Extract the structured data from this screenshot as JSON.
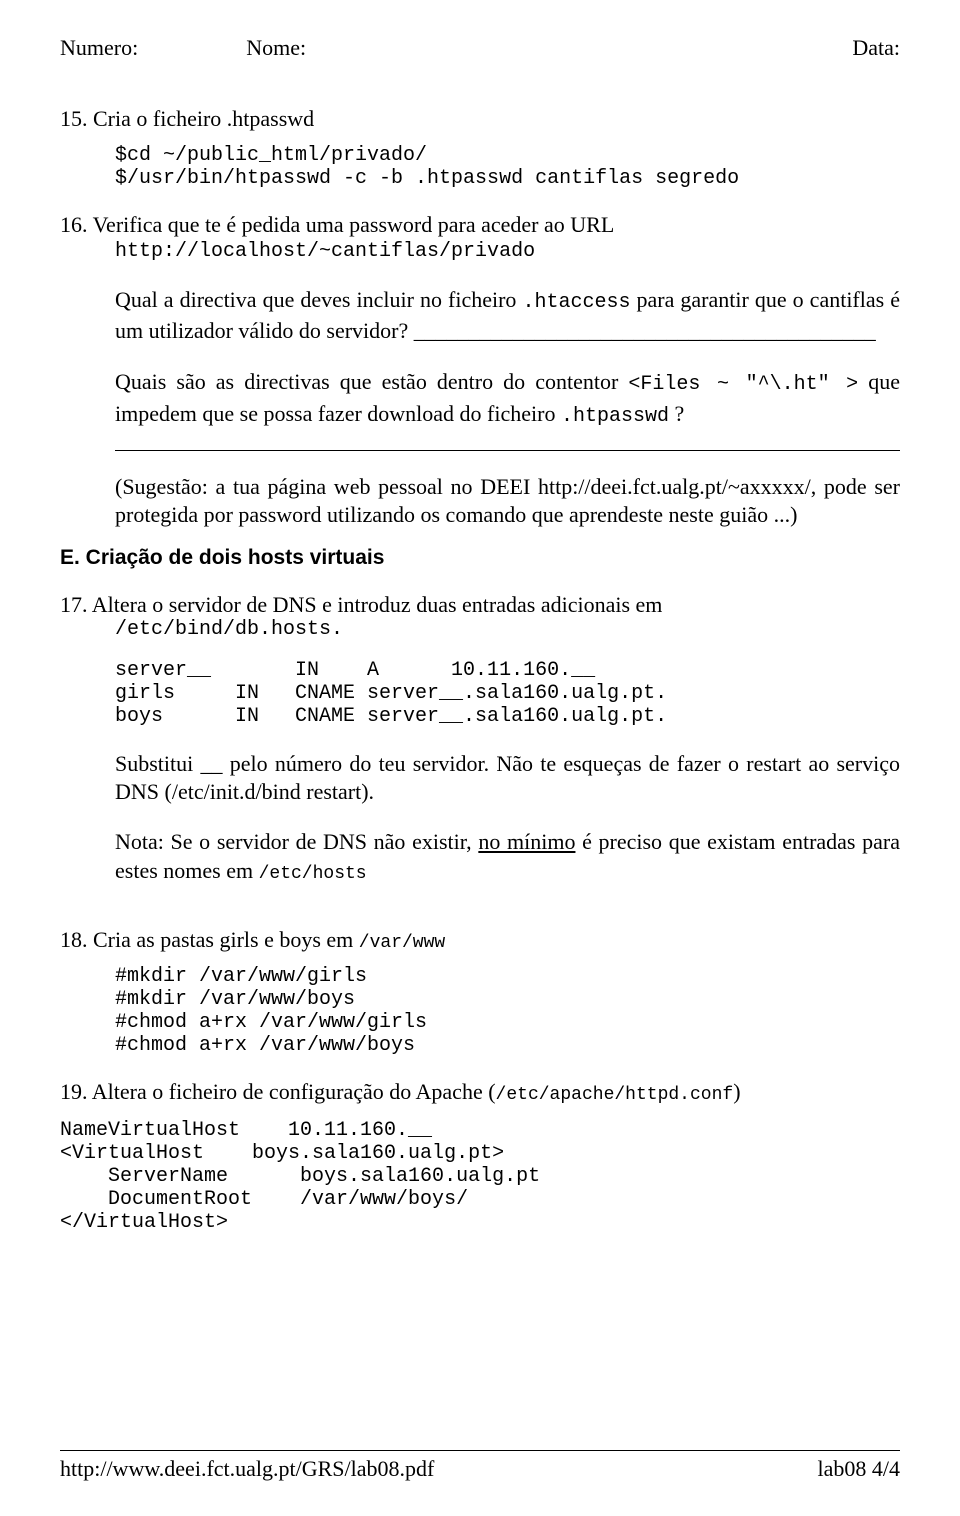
{
  "header": {
    "numero": "Numero:",
    "nome": "Nome:",
    "data": "Data:"
  },
  "item15": {
    "text": "15. Cria o ficheiro .htpasswd",
    "code": "$cd ~/public_html/privado/\n$/usr/bin/htpasswd -c -b .htpasswd cantiflas segredo"
  },
  "item16": {
    "text": "16. Verifica que te é pedida uma password para aceder ao URL",
    "url": "http://localhost/~cantiflas/privado",
    "p1a": "Qual a directiva que deves incluir no ficheiro ",
    "p1code": ".htaccess",
    "p1b": " para garantir que o cantiflas é um utilizador válido do servidor? __________________________________________",
    "p2a": "Quais são as directivas que estão dentro do contentor ",
    "p2code1": "<Files ~ \"^\\.ht\" >",
    "p2b": " que impedem que se possa fazer download do ficheiro ",
    "p2code2": ".htpasswd",
    "p2c": " ?",
    "p3": "(Sugestão: a tua página web pessoal no DEEI http://deei.fct.ualg.pt/~axxxxx/, pode ser protegida por password utilizando os comando que aprendeste neste guião ...)"
  },
  "sectionE": "E. Criação de dois hosts virtuais",
  "item17": {
    "text": "17. Altera o servidor de DNS e introduz duas entradas adicionais em",
    "path": "/etc/bind/db.hosts.",
    "table": "server__       IN    A      10.11.160.__\ngirls     IN   CNAME server__.sala160.ualg.pt.\nboys      IN   CNAME server__.sala160.ualg.pt.",
    "p1": "Substitui __ pelo número do teu servidor. Não te esqueças de fazer o restart ao serviço DNS (/etc/init.d/bind restart).",
    "p2a": "Nota: Se o servidor de DNS não existir, ",
    "p2u": "no mínimo",
    "p2b": " é preciso que existam entradas para estes nomes  em ",
    "p2code": "/etc/hosts"
  },
  "item18": {
    "text_a": "18. Cria as pastas girls e boys em ",
    "text_code": "/var/www",
    "code": "#mkdir /var/www/girls\n#mkdir /var/www/boys\n#chmod a+rx /var/www/girls\n#chmod a+rx /var/www/boys"
  },
  "item19": {
    "text_a": "19. Altera o ficheiro de configuração do Apache (",
    "text_code": "/etc/apache/httpd.conf",
    "text_b": ")"
  },
  "vhost": "NameVirtualHost    10.11.160.__\n<VirtualHost    boys.sala160.ualg.pt>\n    ServerName      boys.sala160.ualg.pt\n    DocumentRoot    /var/www/boys/\n</VirtualHost>",
  "footer": {
    "left": "http://www.deei.fct.ualg.pt/GRS/lab08.pdf",
    "right": "lab08 4/4"
  }
}
